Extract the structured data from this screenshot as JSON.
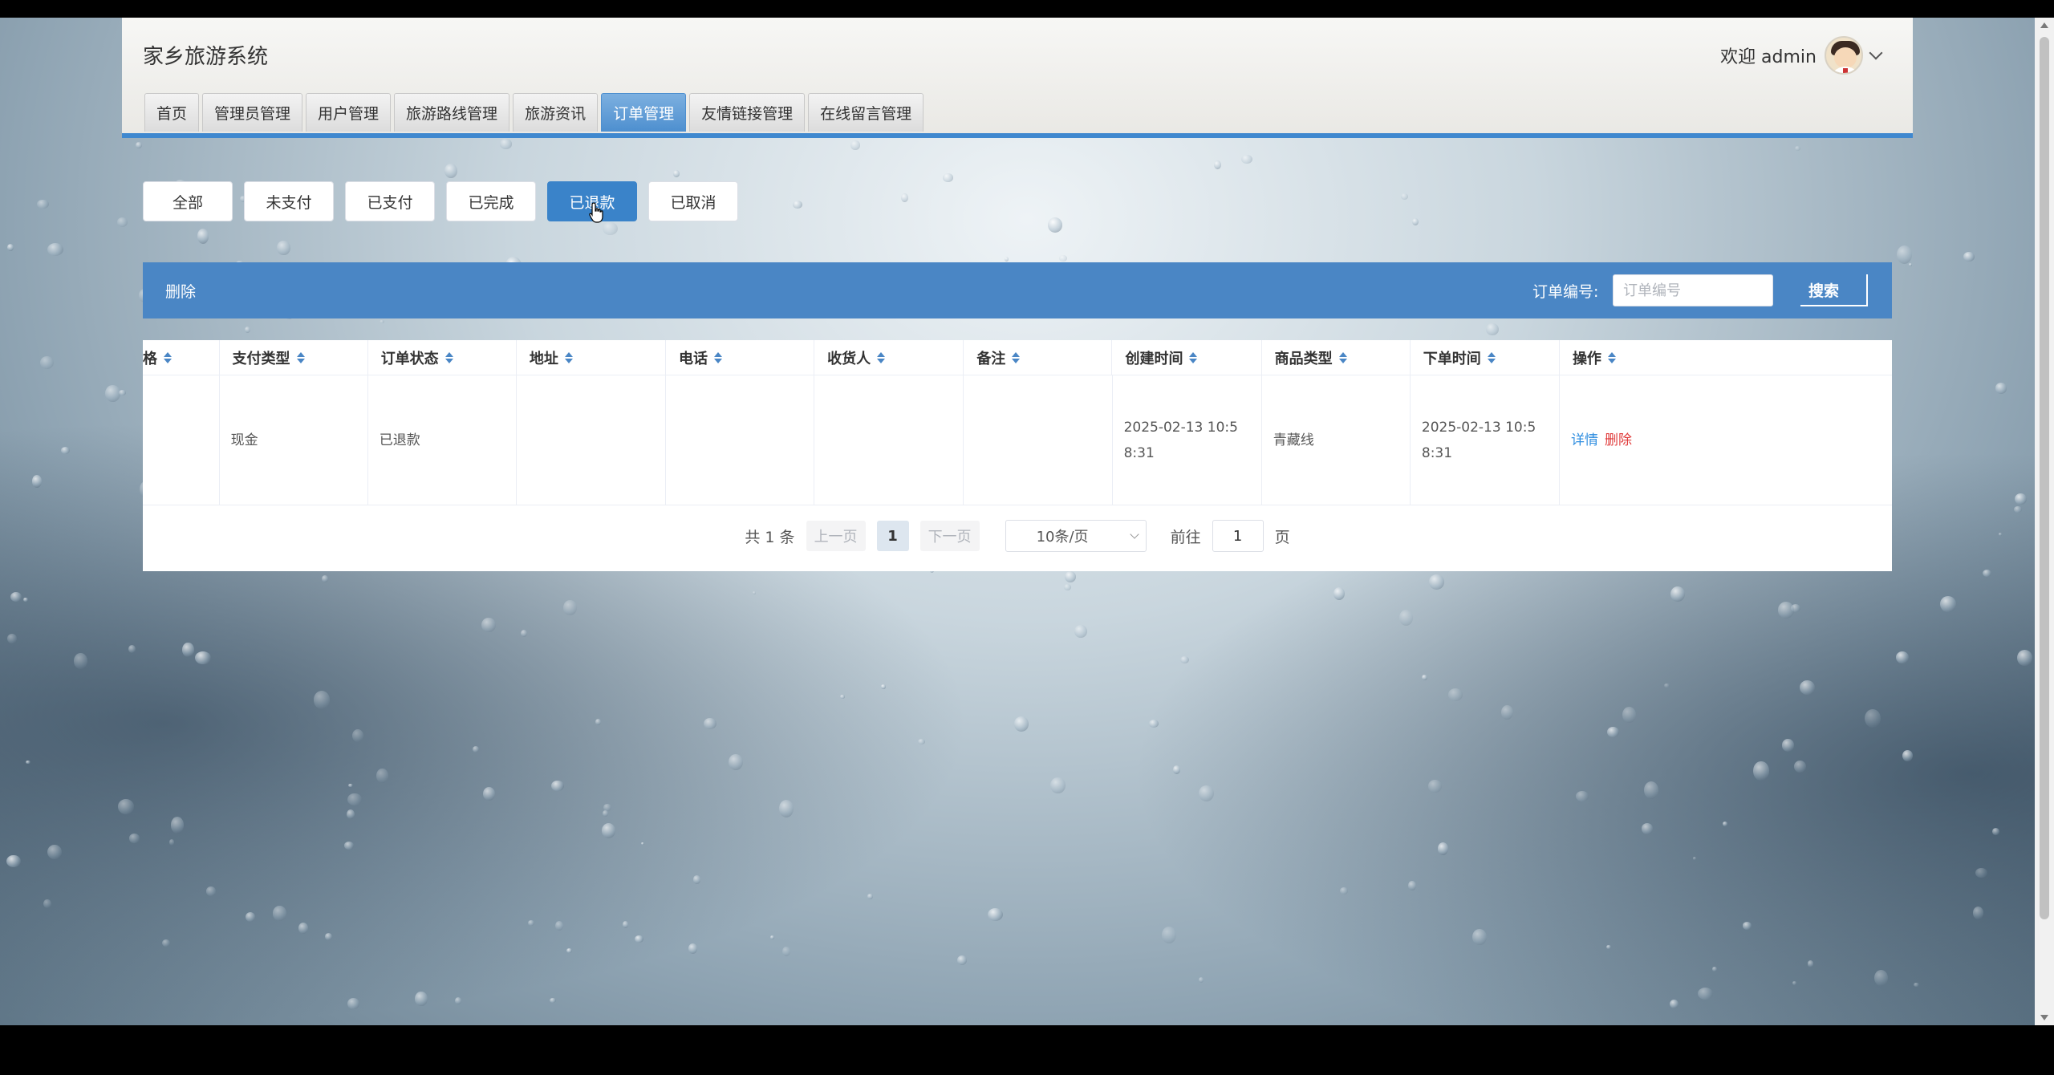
{
  "app": {
    "title": "家乡旅游系统",
    "welcome": "欢迎 admin"
  },
  "nav": {
    "tabs": [
      {
        "label": "首页"
      },
      {
        "label": "管理员管理"
      },
      {
        "label": "用户管理"
      },
      {
        "label": "旅游路线管理"
      },
      {
        "label": "旅游资讯"
      },
      {
        "label": "订单管理",
        "active": true
      },
      {
        "label": "友情链接管理"
      },
      {
        "label": "在线留言管理"
      }
    ]
  },
  "filters": [
    {
      "label": "全部"
    },
    {
      "label": "未支付"
    },
    {
      "label": "已支付"
    },
    {
      "label": "已完成"
    },
    {
      "label": "已退款",
      "active": true
    },
    {
      "label": "已取消"
    }
  ],
  "actionbar": {
    "delete_label": "删除",
    "order_label": "订单编号:",
    "order_placeholder": "订单编号",
    "search_label": "搜索"
  },
  "table": {
    "headers": [
      "格",
      "支付类型",
      "订单状态",
      "地址",
      "电话",
      "收货人",
      "备注",
      "创建时间",
      "商品类型",
      "下单时间",
      "操作"
    ],
    "rows": [
      {
        "c0": "",
        "payment_type": "现金",
        "status": "已退款",
        "address": "",
        "phone": "",
        "consignee": "",
        "remark": "",
        "created": "2025-02-13 10:58:31",
        "goods_type": "青藏线",
        "ordered": "2025-02-13 10:58:31",
        "detail": "详情",
        "delete": "删除"
      }
    ]
  },
  "pager": {
    "total": "共 1 条",
    "prev": "上一页",
    "page": "1",
    "next": "下一页",
    "size": "10条/页",
    "goto_label": "前往",
    "goto_value": "1",
    "page_suffix": "页"
  },
  "colors": {
    "accent": "#4a86c5",
    "nav_active": "#4d8fcf",
    "danger": "#e03a3a",
    "link": "#2f8ee0"
  }
}
